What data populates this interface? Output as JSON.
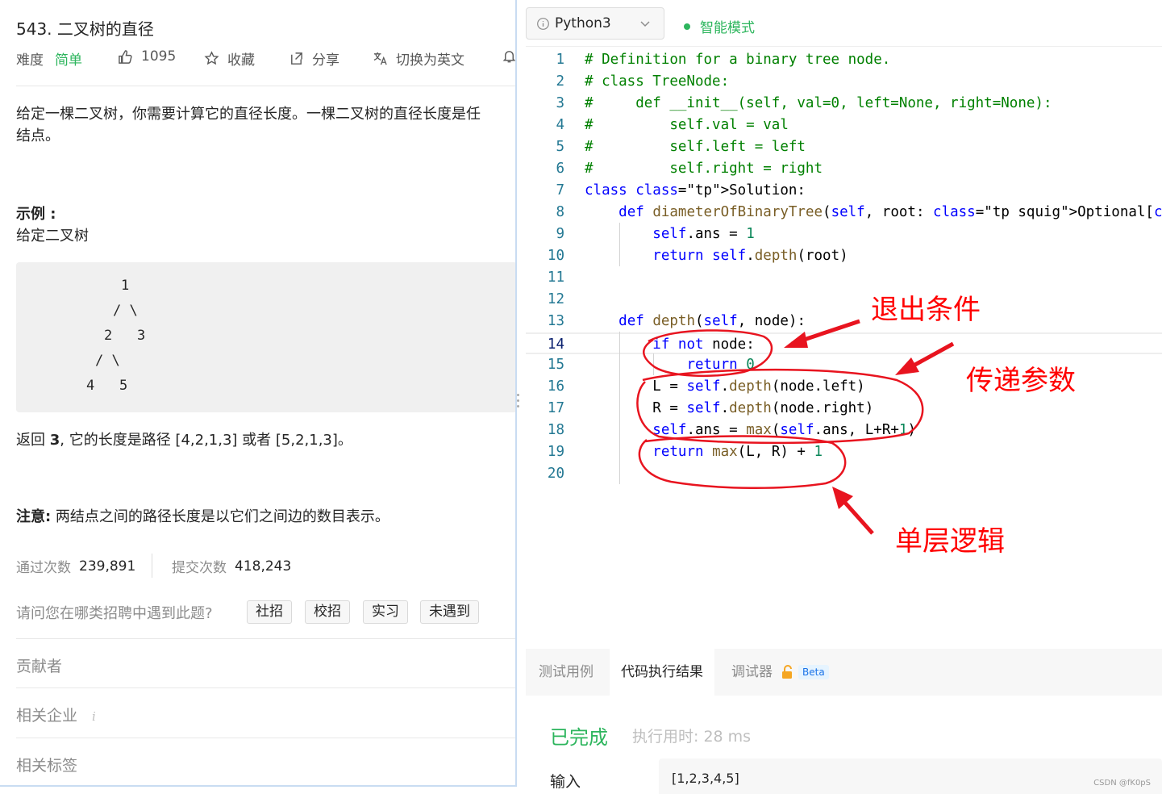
{
  "problem": {
    "title": "543. 二叉树的直径",
    "difficulty_label": "难度",
    "difficulty": "简单",
    "likes": "1095",
    "favorite": "收藏",
    "share": "分享",
    "switch_lang": "切换为英文",
    "desc_line1": "给定一棵二叉树，你需要计算它的直径长度。一棵二叉树的直径长度是任",
    "desc_line2": "结点。",
    "example_title": "示例 :",
    "example_sub": "给定二叉树",
    "tree": [
      "1",
      "/ \\",
      "2   3",
      "/ \\",
      "4   5"
    ],
    "return_prefix": "返回 ",
    "return_value": "3",
    "return_suffix": ", 它的长度是路径 [4,2,1,3] 或者 [5,2,1,3]。",
    "note_label": "注意:",
    "note_text": " 两结点之间的路径长度是以它们之间边的数目表示。",
    "accepted_label": "通过次数",
    "accepted": "239,891",
    "submitted_label": "提交次数",
    "submitted": "418,243",
    "recruit_question": "请问您在哪类招聘中遇到此题?",
    "recruit_options": [
      "社招",
      "校招",
      "实习",
      "未遇到"
    ],
    "contributors": "贡献者",
    "companies": "相关企业",
    "companies_info": "i",
    "tags": "相关标签"
  },
  "editor": {
    "language": "Python3",
    "mode": "智能模式",
    "lines": [
      "# Definition for a binary tree node.",
      "# class TreeNode:",
      "#     def __init__(self, val=0, left=None, right=None):",
      "#         self.val = val",
      "#         self.left = left",
      "#         self.right = right",
      "class Solution:",
      "    def diameterOfBinaryTree(self, root: Optional[TreeNode]) -> int",
      "        self.ans = 1",
      "        return self.depth(root)",
      "",
      "",
      "    def depth(self, node):",
      "        if not node:",
      "            return 0",
      "        L = self.depth(node.left)",
      "        R = self.depth(node.right)",
      "        self.ans = max(self.ans, L+R+1)",
      "        return max(L, R) + 1",
      ""
    ],
    "active_line": 14
  },
  "annotations": {
    "exit_condition": "退出条件",
    "pass_params": "传递参数",
    "single_logic": "单层逻辑",
    "color": "#ff0000"
  },
  "console": {
    "tab_testcase": "测试用例",
    "tab_result": "代码执行结果",
    "tab_debugger": "调试器",
    "beta": "Beta",
    "status": "已完成",
    "runtime": "执行用时: 28 ms",
    "input_label": "输入",
    "input_value": "[1,2,3,4,5]"
  },
  "watermark": "CSDN @fK0pS"
}
